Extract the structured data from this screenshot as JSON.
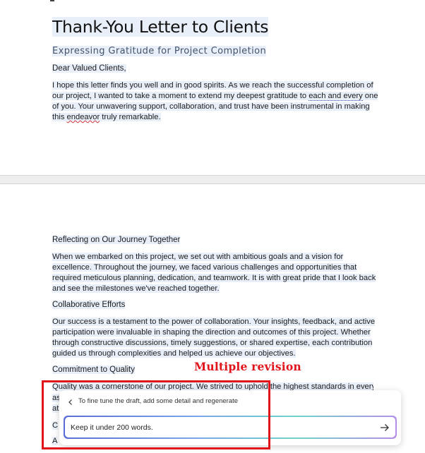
{
  "document": {
    "title": "Thank-You Letter to Clients",
    "subtitle": "Expressing Gratitude for Project Completion",
    "salutation": "Dear Valued Clients,",
    "intro": {
      "part1": "I hope this letter finds you well and in good spirits. As we reach the successful completion of our project, I wanted to take a moment to extend my deepest gratitude to ",
      "dotted": "each and every",
      "part2": " one of you. Your unwavering support, collaboration, and trust have been instrumental in making this ",
      "misspelled": "endeavor",
      "part3": " truly remarkable."
    },
    "sections": {
      "journey_heading": "Reflecting on Our Journey Together",
      "journey_text": "When we embarked on this project, we set out with ambitious goals and a vision for excellence. Throughout the journey, we faced various challenges and opportunities that required meticulous planning, dedication, and teamwork. It is with great pride that I look back and see the milestones we've reached together.",
      "collab_heading": "Collaborative Efforts",
      "collab_text": "Our success is a testament to the power of collaboration. Your insights, feedback, and active participation were invaluable in shaping the direction and outcomes of this project. Whether through constructive discussions, timely suggestions, or shared expertise, each contribution guided us through complexities and helped us achieve our objectives.",
      "quality_heading": "Commitment to Quality",
      "quality_text": "Quality was a cornerstone of our project. We strived to uphold the highest standards in every",
      "stub1": "as",
      "stub2": "at",
      "stub3": "C",
      "stub4": "A"
    }
  },
  "annotation": {
    "label": "Multiple revision",
    "color": "#e0141a"
  },
  "copilot": {
    "back_icon": "chevron-left-icon",
    "previous_prompt": "To fine tune the draft, add some detail and regenerate",
    "input_value": "Keep it under 200 words.",
    "send_icon": "arrow-right-icon"
  }
}
